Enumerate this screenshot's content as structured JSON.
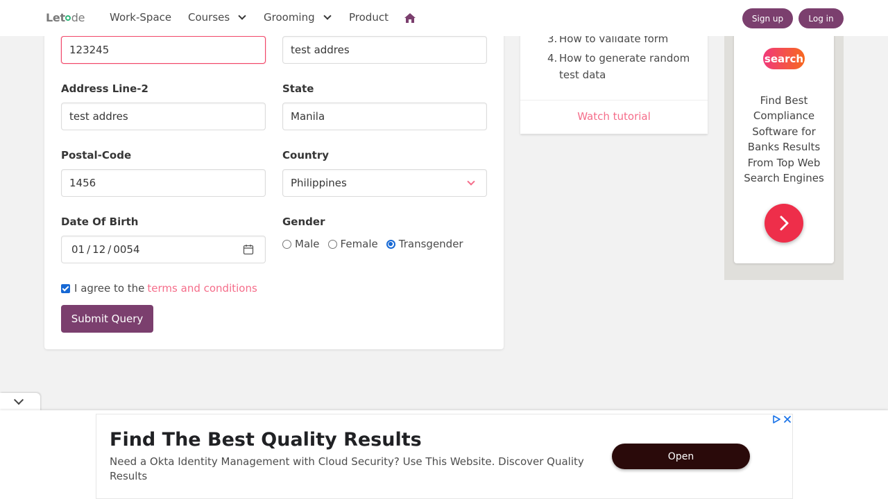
{
  "navbar": {
    "logo": {
      "part1": "Let",
      "part2": "de"
    },
    "items": [
      {
        "label": "Work-Space"
      },
      {
        "label": "Courses"
      },
      {
        "label": "Grooming"
      },
      {
        "label": "Product"
      }
    ],
    "home_icon": "home-icon",
    "signup_label": "Sign up",
    "login_label": "Log in"
  },
  "form": {
    "field1_value": "123245",
    "address1_value": "test addres",
    "address2_label": "Address Line-2",
    "address2_value": "test addres",
    "state_label": "State",
    "state_value": "Manila",
    "postal_label": "Postal-Code",
    "postal_value": "1456",
    "country_label": "Country",
    "country_value": "Philippines",
    "dob_label": "Date Of Birth",
    "dob": {
      "mm": "01",
      "dd": "12",
      "yyyy": "0054",
      "sep": "/"
    },
    "gender_label": "Gender",
    "gender_options": [
      "Male",
      "Female",
      "Transgender"
    ],
    "gender_selected": "Transgender",
    "terms_prefix": "I agree to the",
    "terms_link": "terms and conditions",
    "terms_checked": true,
    "submit_label": "Submit Query"
  },
  "tutorial": {
    "items": [
      {
        "num": "3.",
        "text": "How to validate form"
      },
      {
        "num": "4.",
        "text": "How to generate random test data"
      }
    ],
    "watch_label": "Watch tutorial"
  },
  "side_ad": {
    "logo_text": "search",
    "text": "Find Best Compliance Software for Banks Results From Top Web Search Engines"
  },
  "bottom_ad": {
    "title": "Find The Best Quality Results",
    "description": "Need a Okta Identity Management with Cloud Security? Use This Website. Discover Quality Results",
    "open_label": "Open"
  },
  "colors": {
    "brand": "#7b3f6e",
    "link": "#f56d8a",
    "focus": "#f14668",
    "radio": "#1668d4"
  }
}
